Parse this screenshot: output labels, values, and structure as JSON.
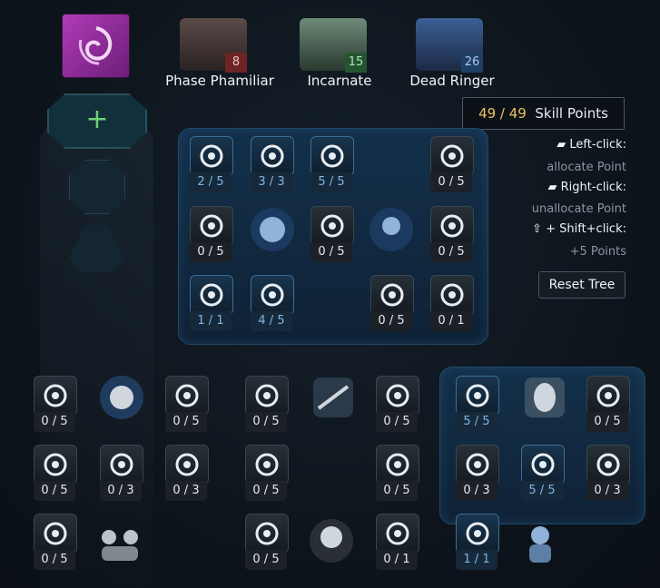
{
  "characters": [
    {
      "name": "Phase Phamiliar",
      "level": "8",
      "color": "#8b2a2a"
    },
    {
      "name": "Incarnate",
      "level": "15",
      "color": "#2f6b3a"
    },
    {
      "name": "Dead Ringer",
      "level": "26",
      "color": "#2a4f78"
    }
  ],
  "add_slot": {
    "icon": "plus-icon"
  },
  "skill_points": {
    "current": "49",
    "max": "49",
    "separator": " / ",
    "label": "Skill Points"
  },
  "help": {
    "left_click": "Left-click:",
    "left_action": "allocate Point",
    "right_click": "Right-click:",
    "right_action": "unallocate Point",
    "shift_click": "+ Shift+click:",
    "shift_action": "+5 Points"
  },
  "reset_label": "Reset Tree",
  "skills": [
    {
      "count": "2 / 5",
      "active": true
    },
    {
      "count": "3 / 3",
      "active": true
    },
    {
      "count": "5 / 5",
      "active": true
    },
    {
      "count": "0 / 5",
      "active": false
    },
    {
      "count": "0 / 5",
      "active": false
    },
    {
      "count": "0 / 5",
      "active": false
    },
    {
      "count": "0 / 5",
      "active": false
    },
    {
      "count": "1 / 1",
      "active": true
    },
    {
      "count": "4 / 5",
      "active": true
    },
    {
      "count": "0 / 5",
      "active": false
    },
    {
      "count": "0 / 1",
      "active": false
    },
    {
      "count": "0 / 5",
      "active": false
    },
    {
      "count": "0 / 5",
      "active": false
    },
    {
      "count": "0 / 5",
      "active": false
    },
    {
      "count": "0 / 5",
      "active": false
    },
    {
      "count": "0 / 5",
      "active": false
    },
    {
      "count": "0 / 3",
      "active": false
    },
    {
      "count": "0 / 3",
      "active": false
    },
    {
      "count": "0 / 5",
      "active": false
    },
    {
      "count": "0 / 5",
      "active": false
    },
    {
      "count": "0 / 5",
      "active": false
    },
    {
      "count": "0 / 5",
      "active": false
    },
    {
      "count": "0 / 1",
      "active": false
    },
    {
      "count": "5 / 5",
      "active": true
    },
    {
      "count": "0 / 5",
      "active": false
    },
    {
      "count": "0 / 3",
      "active": false
    },
    {
      "count": "5 / 5",
      "active": true
    },
    {
      "count": "0 / 3",
      "active": false
    },
    {
      "count": "1 / 1",
      "active": true
    }
  ]
}
